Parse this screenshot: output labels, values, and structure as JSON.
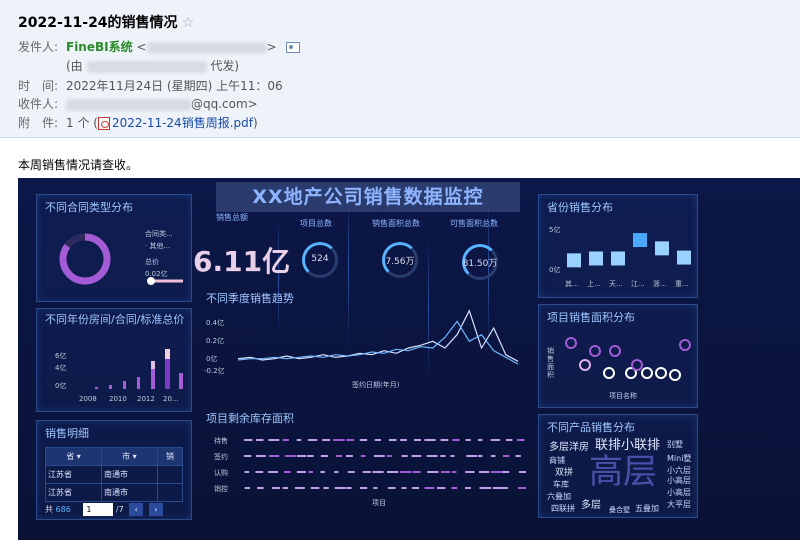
{
  "mail": {
    "subject": "2022-11-24的销售情况",
    "star": "☆",
    "sender_label": "发件人:",
    "sender_name": "FineBI系统",
    "via_prefix": "(由",
    "via_suffix": "代发)",
    "time_label": "时　间:",
    "time_value": "2022年11月24日 (星期四) 上午11：06",
    "to_label": "收件人:",
    "to_suffix": "@qq.com>",
    "attach_label": "附　件:",
    "attach_count": "1 个 (",
    "attach_name": "2022-11-24销售周报.pdf",
    "attach_close": ")",
    "body": "本周销售情况请查收。"
  },
  "dashboard": {
    "title": "XX地产公司销售数据监控",
    "kpi_total_label": "销售总额",
    "kpi_total_value": "6.11亿",
    "kpi_items": [
      {
        "label": "项目总数",
        "value": "524"
      },
      {
        "label": "销售面积总数",
        "value": "7.56万"
      },
      {
        "label": "可售面积总数",
        "value": "81.50万"
      }
    ],
    "panel_contract": {
      "title": "不同合同类型分布",
      "legend1": "合同类...",
      "legend2": "· 其他...",
      "total_label": "总价",
      "total_value": "0.02亿"
    },
    "panel_year": {
      "title": "不同年份房间/合同/标准总价",
      "y_ticks": [
        "6亿",
        "4亿",
        "0亿"
      ],
      "x_ticks": [
        "2008",
        "2010",
        "2012",
        "20..."
      ]
    },
    "panel_detail": {
      "title": "销售明细",
      "headers": [
        "省",
        "市",
        "销"
      ],
      "rows": [
        [
          "江苏省",
          "南通市",
          ""
        ],
        [
          "江苏省",
          "南通市",
          ""
        ]
      ],
      "total_prefix": "共",
      "total": "686",
      "page": "1",
      "page_total": "/7",
      "prev": "‹",
      "next": "›"
    },
    "panel_season": {
      "title": "不同季度销售趋势",
      "y_ticks": [
        "0.4亿",
        "0.2亿",
        "0亿",
        "-0.2亿"
      ],
      "xlabel": "签约日期(年月)"
    },
    "panel_stock": {
      "title": "项目剩余库存面积",
      "rows": [
        "待售",
        "签约",
        "认购",
        "销控"
      ],
      "xlabel": "项目"
    },
    "panel_province": {
      "title": "省份销售分布",
      "y_ticks": [
        "5亿",
        "0亿"
      ],
      "x_ticks": [
        "其...",
        "上...",
        "天...",
        "江...",
        "浙...",
        "重..."
      ]
    },
    "panel_area": {
      "title": "项目销售面积分布",
      "ylabel": "销售面积",
      "xlabel": "项目名称"
    },
    "panel_product": {
      "title": "不同产品销售分布",
      "words": [
        {
          "text": "多层洋房",
          "size": 10,
          "color": "#e0e8ff"
        },
        {
          "text": "联排小联排",
          "size": 13,
          "color": "#e0e8ff"
        },
        {
          "text": "别墅",
          "size": 8,
          "color": "#cfd8ff"
        },
        {
          "text": "商铺",
          "size": 8,
          "color": "#cfd8ff"
        },
        {
          "text": "双拼",
          "size": 9,
          "color": "#e0e8ff"
        },
        {
          "text": "高层",
          "size": 34,
          "color": "#4a4fa8"
        },
        {
          "text": "Mini墅",
          "size": 8,
          "color": "#cfd8ff"
        },
        {
          "text": "小高层",
          "size": 8,
          "color": "#cfd8ff"
        },
        {
          "text": "车库",
          "size": 8,
          "color": "#cfd8ff"
        },
        {
          "text": "小六层",
          "size": 8,
          "color": "#cfd8ff"
        },
        {
          "text": "六叠加",
          "size": 8,
          "color": "#cfd8ff"
        },
        {
          "text": "小高层",
          "size": 8,
          "color": "#cfd8ff"
        },
        {
          "text": "大平层",
          "size": 8,
          "color": "#cfd8ff"
        },
        {
          "text": "四联拼",
          "size": 8,
          "color": "#cfd8ff"
        },
        {
          "text": "多层",
          "size": 10,
          "color": "#e0e8ff"
        },
        {
          "text": "叠合墅",
          "size": 7,
          "color": "#cfd8ff"
        },
        {
          "text": "五叠加",
          "size": 8,
          "color": "#cfd8ff"
        }
      ]
    }
  },
  "colors": {
    "accent": "#58b4ff",
    "purple": "#a35bd6",
    "pink": "#f0c0d8"
  },
  "chart_data": [
    {
      "type": "bar",
      "title": "省份销售分布",
      "categories": [
        "其...",
        "上...",
        "天...",
        "江...",
        "浙...",
        "重..."
      ],
      "values": [
        0.4,
        0.6,
        0.6,
        2.6,
        1.7,
        0.7
      ],
      "ylim": [
        0,
        5
      ]
    },
    {
      "type": "line",
      "title": "不同季度销售趋势",
      "xlabel": "签约日期(年月)",
      "series": [
        {
          "values": [
            0.02,
            0.03,
            0.01,
            0.02,
            0.04,
            0.02,
            0.03,
            0.05,
            0.03,
            0.04,
            0.06,
            0.05,
            0.08,
            0.06,
            0.1,
            0.12,
            0.15,
            0.1,
            0.2,
            0.38,
            0.1,
            0.25,
            0.05,
            0.0
          ]
        },
        {
          "values": [
            0.01,
            0.02,
            0.02,
            0.03,
            0.02,
            0.03,
            0.04,
            0.03,
            0.05,
            0.04,
            0.05,
            0.07,
            0.06,
            0.09,
            0.08,
            0.11,
            0.1,
            0.18,
            0.3,
            0.15,
            0.2,
            0.08,
            0.03,
            -0.02
          ]
        }
      ],
      "ylim": [
        -0.2,
        0.4
      ]
    },
    {
      "type": "pie",
      "title": "不同合同类型分布",
      "values": [
        0.85,
        0.15
      ]
    }
  ]
}
